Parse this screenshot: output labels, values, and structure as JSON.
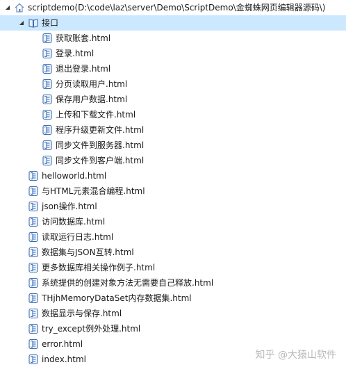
{
  "tree": {
    "root": {
      "label": "scriptdemo(D:\\code\\laz\\server\\Demo\\ScriptDemo\\金蜘蛛网页编辑器源码\\)"
    },
    "folder": {
      "label": "接口",
      "children": [
        "获取账套.html",
        "登录.html",
        "退出登录.html",
        "分页读取用户.html",
        "保存用户数据.html",
        "上传和下载文件.html",
        "程序升级更新文件.html",
        "同步文件到服务器.html",
        "同步文件到客户端.html"
      ]
    },
    "files": [
      "helloworld.html",
      "与HTML元素混合编程.html",
      "json操作.html",
      "访问数据库.html",
      "读取运行日志.html",
      "数据集与JSON互转.html",
      "更多数据库相关操作例子.html",
      "系统提供的创建对象方法无需要自己释放.html",
      "THjhMemoryDataSet内存数据集.html",
      "数据显示与保存.html",
      "try_except例外处理.html",
      "error.html",
      "index.html"
    ]
  },
  "icons": {
    "root": "home-icon",
    "folder": "book-icon",
    "file": "script-page-icon",
    "expanded": "expanded-triangle-icon",
    "root_expanded": "expanded-triangle-icon"
  },
  "colors": {
    "selection": "#cce8ff",
    "icon_blue": "#3b6fb6",
    "text": "#1a1a1a",
    "watermark": "#b8b8b8"
  },
  "watermark": "知乎 @大猿山软件"
}
